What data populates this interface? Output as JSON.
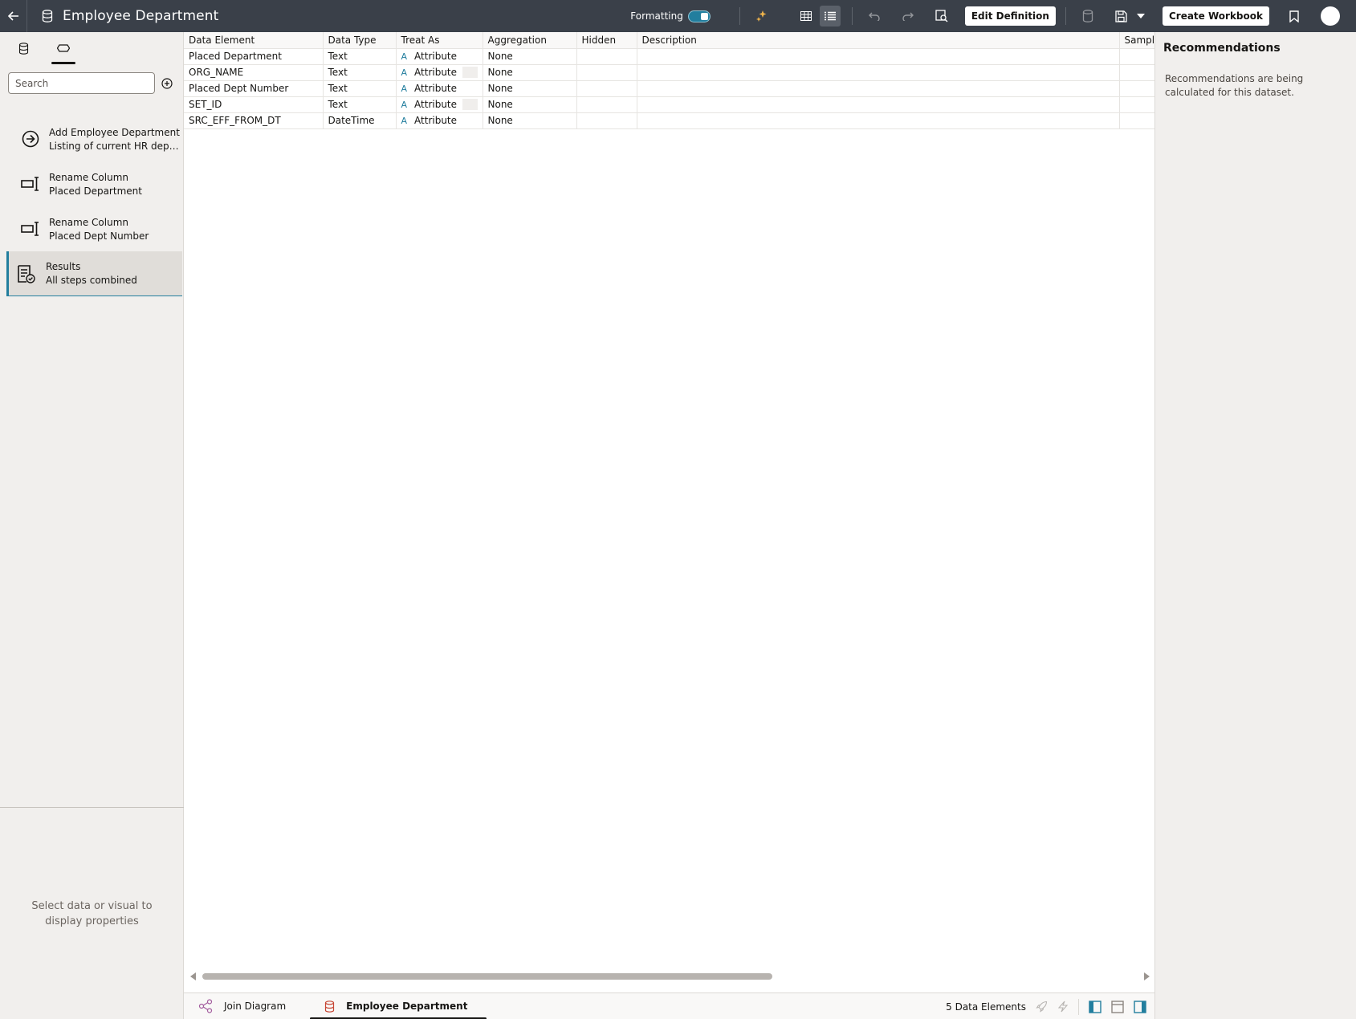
{
  "header": {
    "title": "Employee Department",
    "formatting_label": "Formatting",
    "edit_definition_label": "Edit Definition",
    "create_workbook_label": "Create Workbook"
  },
  "sidebar": {
    "search_placeholder": "Search",
    "steps": [
      {
        "title": "Add Employee Department",
        "subtitle": "Listing of current HR depar..."
      },
      {
        "title": "Rename Column",
        "subtitle": "Placed Department"
      },
      {
        "title": "Rename Column",
        "subtitle": "Placed Dept Number"
      },
      {
        "title": "Results",
        "subtitle": "All steps combined"
      }
    ],
    "properties_placeholder": "Select data or visual to display properties"
  },
  "grid": {
    "columns": [
      "Data Element",
      "Data Type",
      "Treat As",
      "Aggregation",
      "Hidden",
      "Description",
      "Sample"
    ],
    "rows": [
      {
        "element": "Placed Department",
        "type": "Text",
        "treat_as": "Attribute",
        "aggregation": "None"
      },
      {
        "element": "ORG_NAME",
        "type": "Text",
        "treat_as": "Attribute",
        "aggregation": "None"
      },
      {
        "element": "Placed Dept Number",
        "type": "Text",
        "treat_as": "Attribute",
        "aggregation": "None"
      },
      {
        "element": "SET_ID",
        "type": "Text",
        "treat_as": "Attribute",
        "aggregation": "None"
      },
      {
        "element": "SRC_EFF_FROM_DT",
        "type": "DateTime",
        "treat_as": "Attribute",
        "aggregation": "None"
      }
    ],
    "attribute_icon_glyph": "A"
  },
  "recommendations": {
    "title": "Recommendations",
    "message": "Recommendations are being calculated for this dataset."
  },
  "bottom": {
    "tabs": [
      "Join Diagram",
      "Employee Department"
    ],
    "data_elements_count": "5 Data Elements"
  },
  "colors": {
    "header_bg": "#3a4049",
    "accent": "#227e9e",
    "dataset_icon": "#c74634",
    "join_icon": "#a35c9e"
  }
}
